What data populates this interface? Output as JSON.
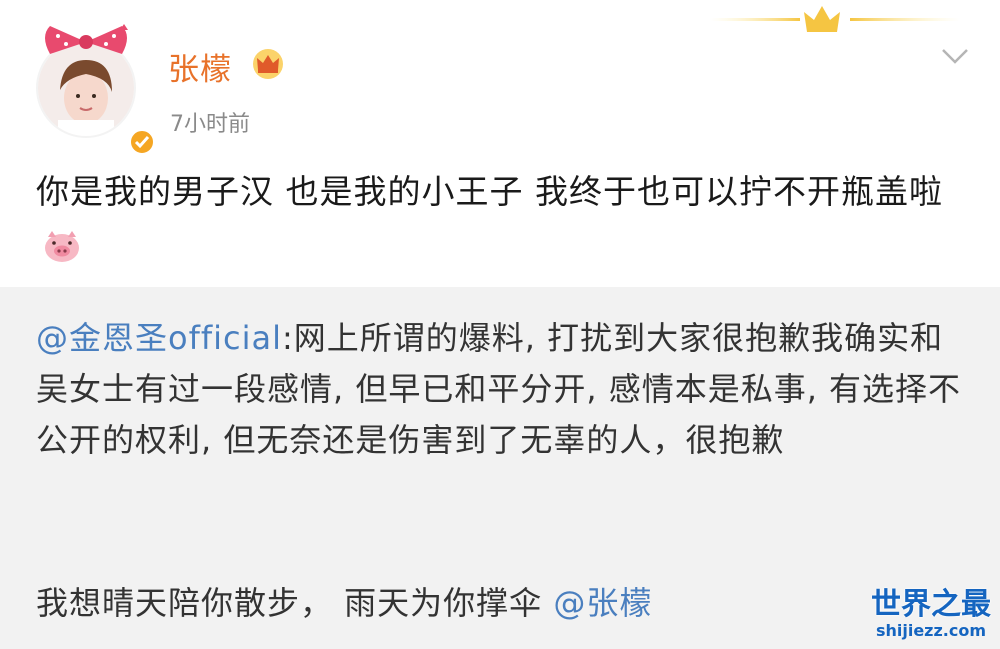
{
  "post": {
    "username": "张檬",
    "timestamp": "7小时前",
    "text": "你是我的男子汉  也是我的小王子  我终于也可以拧不开瓶盖啦",
    "emoji": "pig-face-icon"
  },
  "repost": {
    "mention_user": "@金恩圣official",
    "text": ":网上所谓的爆料, 打扰到大家很抱歉我确实和吴女士有过一段感情, 但早已和平分开, 感情本是私事, 有选择不公开的权利, 但无奈还是伤害到了无辜的人，很抱歉",
    "text2": "我想晴天陪你散步，  雨天为你撑伞 ",
    "mention_user2": "@张檬"
  },
  "watermark": {
    "title": "世界之最",
    "url": "shijiezz.com"
  },
  "colors": {
    "username": "#e8722a",
    "mention": "#4a7fbf",
    "verified": "#f5a623",
    "watermark": "#1565c0"
  }
}
